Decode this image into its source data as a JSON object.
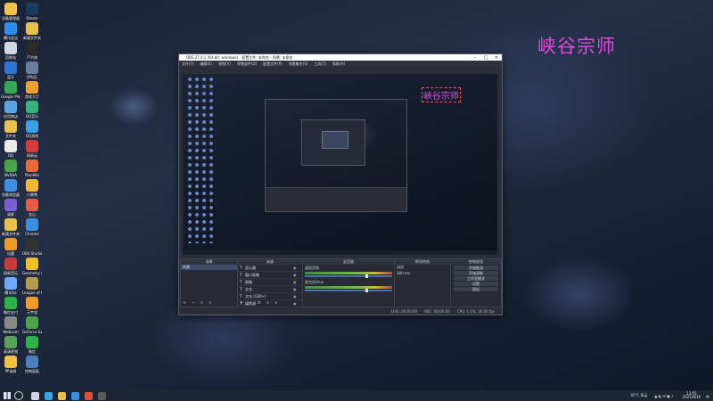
{
  "desktop": {
    "icons": [
      {
        "label": "设备管理器",
        "color": "#f2c14a"
      },
      {
        "label": "腾讯会议",
        "color": "#2f8cf0"
      },
      {
        "label": "回收站",
        "color": "#cfd6e2"
      },
      {
        "label": "蓝牙",
        "color": "#2e74d4"
      },
      {
        "label": "Google Play",
        "color": "#34a853"
      },
      {
        "label": "应用商店",
        "color": "#59a5e8"
      },
      {
        "label": "文件夹",
        "color": "#e8c04a"
      },
      {
        "label": "QQ",
        "color": "#e9e9e9"
      },
      {
        "label": "NVIDIA",
        "color": "#4aa34a"
      },
      {
        "label": "谷歌浏览器",
        "color": "#3c8ede"
      },
      {
        "label": "录屏",
        "color": "#7a5fd0"
      },
      {
        "label": "新建文件夹",
        "color": "#e8c04a"
      },
      {
        "label": "迅雷",
        "color": "#f09a2a"
      },
      {
        "label": "网易音乐",
        "color": "#c93a3a"
      },
      {
        "label": "腾讯Xa",
        "color": "#6fa8ff"
      },
      {
        "label": "微信支付",
        "color": "#2bb34a"
      },
      {
        "label": "Webcam",
        "color": "#888"
      },
      {
        "label": "高清视频",
        "color": "#5aa05a"
      },
      {
        "label": "PP录屏",
        "color": "#f0c040"
      },
      {
        "label": "Steam",
        "color": "#1a3a5f"
      },
      {
        "label": "新建文件夹",
        "color": "#e8c04a"
      },
      {
        "label": "??节拍",
        "color": "#2a2a2a"
      },
      {
        "label": "伊利石",
        "color": "#6a7f9f"
      },
      {
        "label": "游戏大厅",
        "color": "#f0a030"
      },
      {
        "label": "QQ音乐",
        "color": "#36b37e"
      },
      {
        "label": "QQ游戏",
        "color": "#39a0e5"
      },
      {
        "label": "网易云",
        "color": "#d33a3a"
      },
      {
        "label": "PlanWin",
        "color": "#e86a3a"
      },
      {
        "label": "小黄鸭",
        "color": "#f2b63a"
      },
      {
        "label": "金山",
        "color": "#e85a4a"
      },
      {
        "label": "Chrome",
        "color": "#3c8ede"
      },
      {
        "label": "OBS Studio",
        "color": "#333"
      },
      {
        "label": "Geometry Dash",
        "color": "#f0c030"
      },
      {
        "label": "League of Legends",
        "color": "#b99a4a"
      },
      {
        "label": "元宇宙",
        "color": "#f09a2a"
      },
      {
        "label": "GeForce Experience",
        "color": "#4aa34a"
      },
      {
        "label": "微信",
        "color": "#2bb34a"
      },
      {
        "label": "控制面板",
        "color": "#4a7fc0"
      }
    ],
    "watermark": "峡谷宗师"
  },
  "obs": {
    "title": "OBS 27.0.1 (64-bit, windows) - 配置文件: 未命名 - 场景: 未命名",
    "menu": [
      "文件(F)",
      "编辑(E)",
      "视图(V)",
      "停靠部件(D)",
      "配置文件(P)",
      "场景集合(S)",
      "工具(T)",
      "帮助(H)"
    ],
    "preview_label": "峡谷宗师",
    "docks": {
      "scenes": {
        "header": "场景",
        "items": [
          "场景"
        ]
      },
      "sources": {
        "header": "来源",
        "items": [
          "显示器",
          "窗口采集",
          "图像",
          "文本",
          "文本 (GDI+)",
          "媒体源"
        ]
      },
      "mixer": {
        "header": "混音器",
        "tracks": [
          {
            "name": "桌面音频",
            "db": "0.0 dB"
          },
          {
            "name": "麦克风/Aux",
            "db": "0.0 dB"
          }
        ]
      },
      "transitions": {
        "header": "转场特效",
        "type": "淡出",
        "duration": "300 ms"
      },
      "controls": {
        "header": "控制按钮",
        "buttons": [
          "开始推流",
          "开始录制",
          "工作室模式",
          "设置",
          "退出"
        ]
      }
    },
    "status": {
      "live": "LIVE: 00:00:00",
      "rec": "REC: 00:00:00",
      "cpu": "CPU: 1.1%, 30.00 fps"
    }
  },
  "taskbar": {
    "icons": [
      {
        "name": "task-view-icon",
        "color": "#cfd6e2"
      },
      {
        "name": "edge-icon",
        "color": "#3aa0e0"
      },
      {
        "name": "explorer-icon",
        "color": "#e8c04a"
      },
      {
        "name": "chrome-icon",
        "color": "#3c8ede"
      },
      {
        "name": "app-icon",
        "color": "#e24a3a"
      },
      {
        "name": "obs-icon",
        "color": "#5a5a5a"
      }
    ],
    "weather": "31°C 多云",
    "time": "13:55",
    "date": "2021/8/19"
  }
}
